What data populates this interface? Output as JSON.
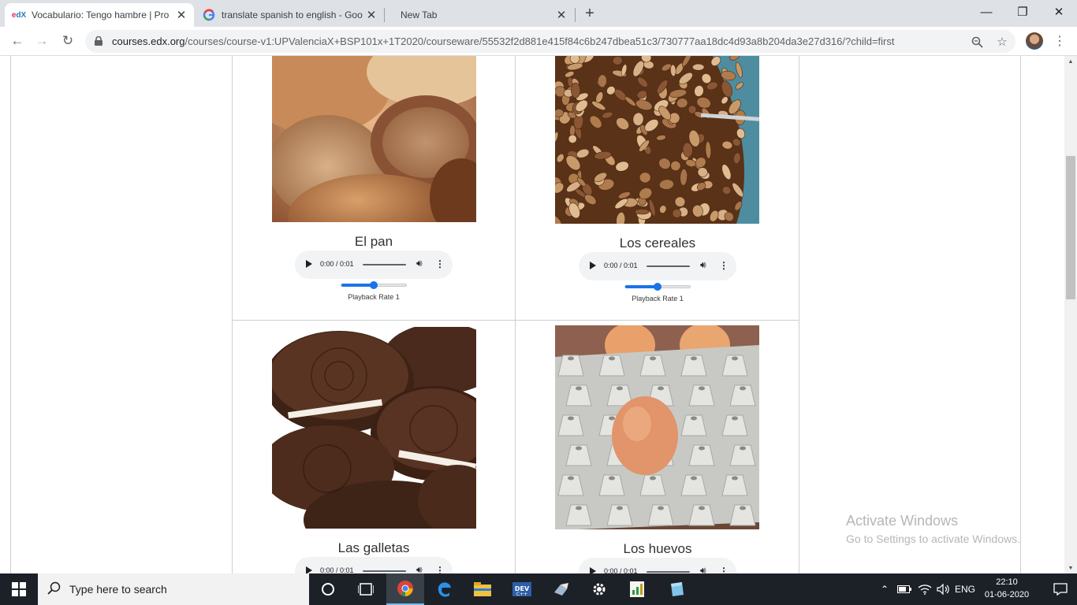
{
  "browser": {
    "tabs": [
      {
        "title": "Vocabulario: Tengo hambre | Pro",
        "favicon": "edX",
        "active": true
      },
      {
        "title": "translate spanish to english - Goo",
        "favicon": "G",
        "active": false
      },
      {
        "title": "New Tab",
        "favicon": "",
        "active": false
      }
    ],
    "new_tab_symbol": "+",
    "window_controls": {
      "minimize": "—",
      "restore": "❐",
      "close": "✕"
    },
    "address": {
      "host": "courses.edx.org",
      "path": "/courses/course-v1:UPValenciaX+BSP101x+1T2020/courseware/55532f2d881e415f84c6b247dbea51c3/730777aa18dc4d93a8b204da3e27d316/?child=first"
    },
    "nav": {
      "back": "←",
      "forward": "→",
      "reload": "↻"
    }
  },
  "content": {
    "items": [
      {
        "caption": "El pan",
        "image": "bread-photo",
        "time": "0:00 / 0:01",
        "rate_label": "Playback Rate 1",
        "rate_fraction": 0.5
      },
      {
        "caption": "Los cereales",
        "image": "cereal-photo",
        "time": "0:00 / 0:01",
        "rate_label": "Playback Rate 1",
        "rate_fraction": 0.5
      },
      {
        "caption": "Las galletas",
        "image": "cookies-photo",
        "time": "0:00 / 0:01"
      },
      {
        "caption": "Los huevos",
        "image": "eggs-photo",
        "time": "0:00 / 0:01"
      }
    ]
  },
  "watermark": {
    "line1": "Activate Windows",
    "line2": "Go to Settings to activate Windows."
  },
  "taskbar": {
    "search_placeholder": "Type here to search",
    "language": "ENG",
    "time": "22:10",
    "date": "01-06-2020"
  }
}
